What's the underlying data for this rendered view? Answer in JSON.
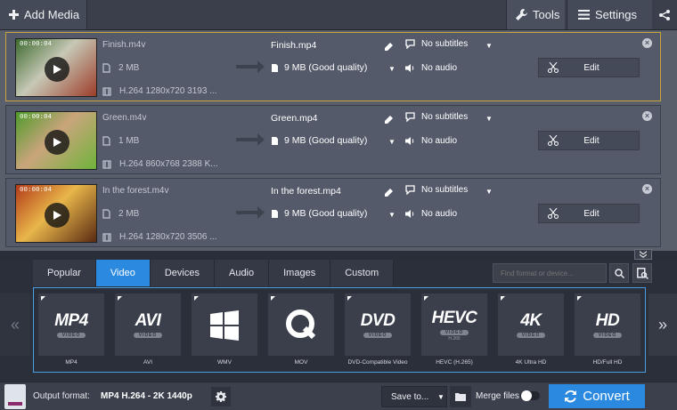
{
  "toolbar": {
    "add_media": "Add Media",
    "tools": "Tools",
    "settings": "Settings"
  },
  "files": [
    {
      "duration": "00:00:04",
      "name": "Finish.m4v",
      "size": "2 MB",
      "codec": "H.264 1280x720 3193 ...",
      "output_name": "Finish.mp4",
      "output_size": "9 MB (Good quality)",
      "subtitles": "No subtitles",
      "audio": "No audio",
      "edit": "Edit",
      "selected": true,
      "thumb_colors": [
        "#3d6a2e",
        "#c7c8b6",
        "#9d3d2a"
      ]
    },
    {
      "duration": "00:00:04",
      "name": "Green.m4v",
      "size": "1 MB",
      "codec": "H.264 860x768 2388 K...",
      "output_name": "Green.mp4",
      "output_size": "9 MB (Good quality)",
      "subtitles": "No subtitles",
      "audio": "No audio",
      "edit": "Edit",
      "selected": false,
      "thumb_colors": [
        "#4e9a2a",
        "#caa57c",
        "#6fb33a"
      ]
    },
    {
      "duration": "00:00:04",
      "name": "In the forest.m4v",
      "size": "2 MB",
      "codec": "H.264 1280x720 3506 ...",
      "output_name": "In the forest.mp4",
      "output_size": "9 MB (Good quality)",
      "subtitles": "No subtitles",
      "audio": "No audio",
      "edit": "Edit",
      "selected": false,
      "thumb_colors": [
        "#b23a18",
        "#e8b64a",
        "#5a2a12"
      ]
    }
  ],
  "tabs": [
    "Popular",
    "Video",
    "Devices",
    "Audio",
    "Images",
    "Custom"
  ],
  "active_tab": "Video",
  "search": {
    "placeholder": "Find format or device..."
  },
  "formats": [
    {
      "big": "MP4",
      "sub": "VIDEO",
      "label": "MP4"
    },
    {
      "big": "AVI",
      "sub": "VIDEO",
      "label": "AVI"
    },
    {
      "big": "",
      "sub": "",
      "label": "WMV",
      "icon": "windows-logo-icon"
    },
    {
      "big": "",
      "sub": "",
      "label": "MOV",
      "icon": "quicktime-logo-icon"
    },
    {
      "big": "DVD",
      "sub": "VIDEO",
      "label": "DVD-Compatible Video"
    },
    {
      "big": "HEVC",
      "sub": "VIDEO",
      "extra": "H.265",
      "label": "HEVC (H.265)"
    },
    {
      "big": "4K",
      "sub": "VIDEO",
      "label": "4K Ultra HD"
    },
    {
      "big": "HD",
      "sub": "VIDEO",
      "label": "HD/Full HD"
    }
  ],
  "status": {
    "output_label": "Output format:",
    "output_value": "MP4 H.264 - 2K 1440p",
    "save_to": "Save to...",
    "merge": "Merge files",
    "convert": "Convert"
  },
  "colors": {
    "accent": "#2b8ae0",
    "selected_border": "#c7a53d"
  }
}
